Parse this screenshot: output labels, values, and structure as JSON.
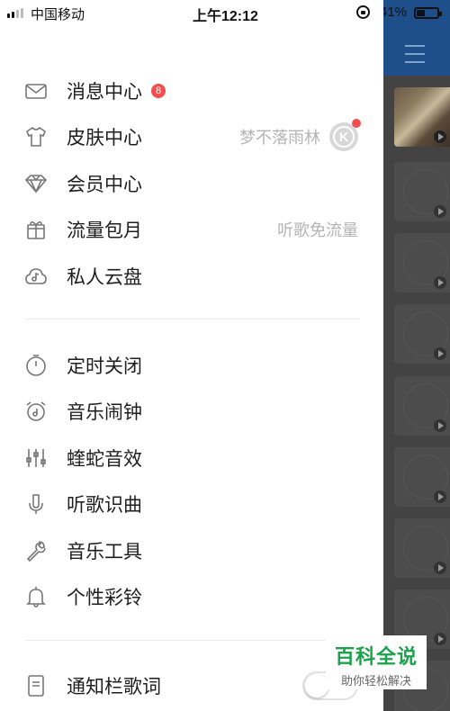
{
  "status_bar": {
    "carrier": "中国移动",
    "time": "上午12:12",
    "battery": "41%"
  },
  "menu_primary": [
    {
      "label": "消息中心",
      "icon": "envelope-icon",
      "badge": "8"
    },
    {
      "label": "皮肤中心",
      "icon": "tshirt-icon",
      "right_text": "梦不落雨林",
      "right_logo": "K"
    },
    {
      "label": "会员中心",
      "icon": "diamond-icon"
    },
    {
      "label": "流量包月",
      "icon": "gift-icon",
      "right_text": "听歌免流量"
    },
    {
      "label": "私人云盘",
      "icon": "cloud-music-icon"
    }
  ],
  "menu_secondary": [
    {
      "label": "定时关闭",
      "icon": "timer-icon"
    },
    {
      "label": "音乐闹钟",
      "icon": "alarm-clock-icon"
    },
    {
      "label": "蝰蛇音效",
      "icon": "equalizer-icon"
    },
    {
      "label": "听歌识曲",
      "icon": "mic-icon"
    },
    {
      "label": "音乐工具",
      "icon": "wrench-icon"
    },
    {
      "label": "个性彩铃",
      "icon": "bell-icon"
    }
  ],
  "menu_tertiary": [
    {
      "label": "通知栏歌词",
      "icon": "document-icon",
      "toggle": false
    }
  ],
  "watermark": {
    "title": "百科全说",
    "subtitle": "助你轻松解决"
  },
  "colors": {
    "badge": "#f34e4e",
    "right_header": "#1f4f8a",
    "overlay": "#434343",
    "watermark_green": "#1aa34a"
  }
}
